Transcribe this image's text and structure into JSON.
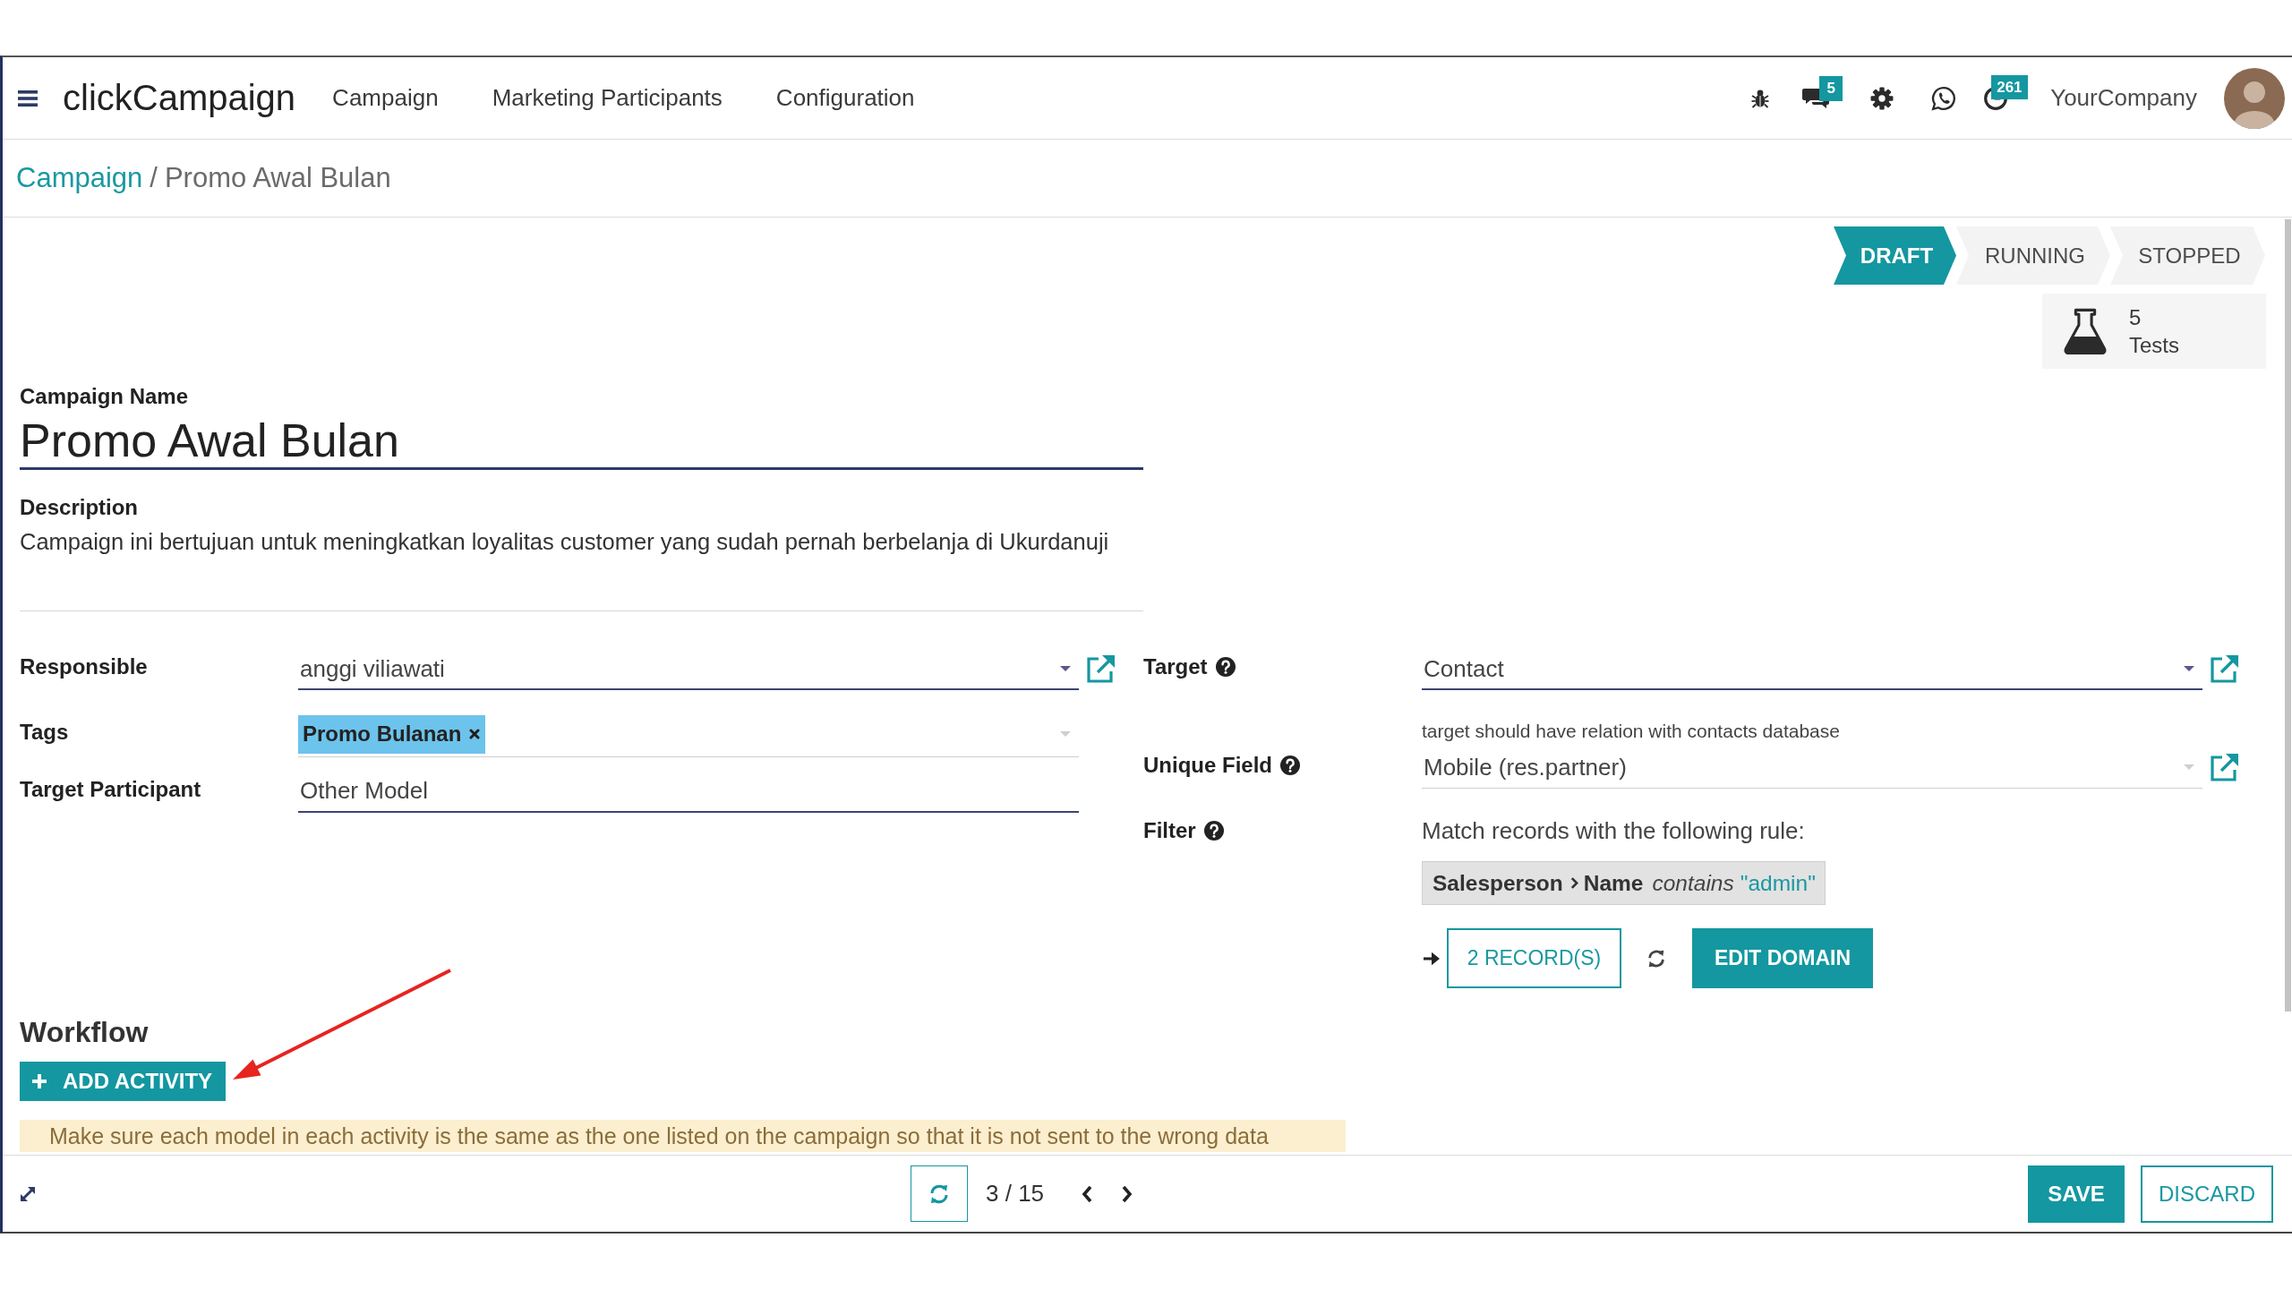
{
  "navbar": {
    "app_name": "clickCampaign",
    "menu": [
      {
        "label": "Campaign"
      },
      {
        "label": "Marketing Participants"
      },
      {
        "label": "Configuration"
      }
    ],
    "messages_badge": "5",
    "activities_badge": "261",
    "company": "YourCompany"
  },
  "breadcrumb": {
    "separator": "/",
    "items": [
      {
        "label": "Campaign",
        "current": false
      },
      {
        "label": "Promo Awal Bulan",
        "current": true
      }
    ]
  },
  "status_bar": [
    {
      "label": "DRAFT",
      "selected": true
    },
    {
      "label": "RUNNING",
      "selected": false
    },
    {
      "label": "STOPPED",
      "selected": false
    }
  ],
  "stat_button": {
    "count": "5",
    "label": "Tests"
  },
  "form": {
    "name_label": "Campaign Name",
    "name": "Promo Awal Bulan",
    "description_label": "Description",
    "description": "Campaign ini bertujuan untuk meningkatkan loyalitas customer yang sudah pernah berbelanja di Ukurdanuji",
    "left_fields": [
      {
        "kind": "many2one",
        "label": "Responsible",
        "value": "anggi viliawati",
        "required": true
      },
      {
        "kind": "tags",
        "label": "Tags",
        "tags": [
          "Promo Bulanan"
        ],
        "required": false
      },
      {
        "kind": "text",
        "label": "Target Participant",
        "value": "Other Model",
        "required": true
      }
    ],
    "right_fields": [
      {
        "kind": "many2one",
        "label": "Target",
        "help": true,
        "value": "Contact",
        "required": true
      },
      {
        "kind": "many2one",
        "label": "Unique Field",
        "help": true,
        "hint": "target should have relation with contacts database",
        "value": "Mobile (res.partner)",
        "required": false
      },
      {
        "kind": "domain",
        "label": "Filter",
        "help": true,
        "intro": "Match records with the following rule:",
        "rule": {
          "path": [
            "Salesperson",
            "Name"
          ],
          "operator": "contains",
          "value": "\"admin\""
        },
        "records_button": "2 RECORD(S)",
        "edit_button": "EDIT DOMAIN"
      }
    ]
  },
  "workflow": {
    "title": "Workflow",
    "add_button": "ADD ACTIVITY",
    "notice": "Make sure each model in each activity is the same as the one listed on the campaign so that it is not sent to the wrong data"
  },
  "footer": {
    "pager": "3 / 15",
    "save_button": "SAVE",
    "discard_button": "DISCARD"
  }
}
